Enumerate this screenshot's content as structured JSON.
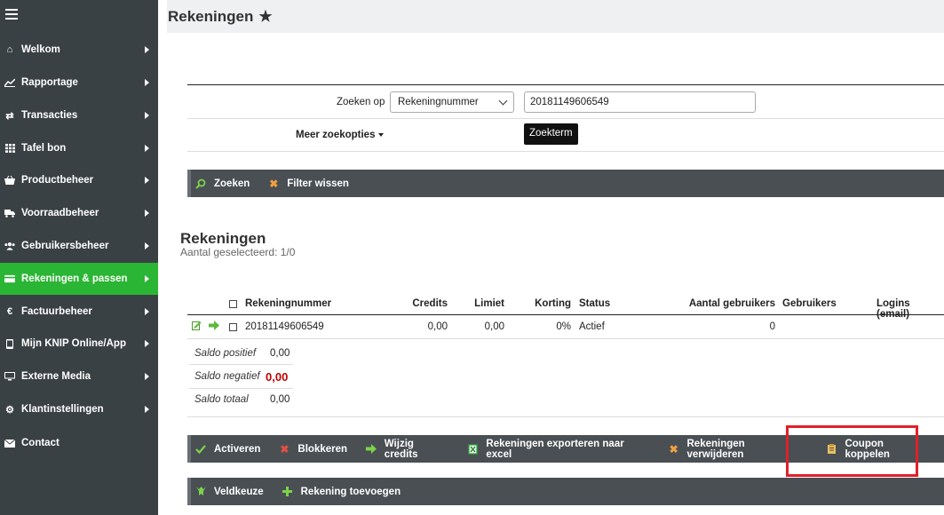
{
  "sidebar": {
    "items": [
      {
        "label": "Welkom",
        "icon": "home-icon"
      },
      {
        "label": "Rapportage",
        "icon": "chart-icon"
      },
      {
        "label": "Transacties",
        "icon": "exchange-icon"
      },
      {
        "label": "Tafel bon",
        "icon": "grid-icon"
      },
      {
        "label": "Productbeheer",
        "icon": "basket-icon"
      },
      {
        "label": "Voorraadbeheer",
        "icon": "truck-icon"
      },
      {
        "label": "Gebruikersbeheer",
        "icon": "users-icon"
      },
      {
        "label": "Rekeningen & passen",
        "icon": "credit-card-icon"
      },
      {
        "label": "Factuurbeheer",
        "icon": "euro-icon"
      },
      {
        "label": "Mijn KNIP Online/App",
        "icon": "mobile-icon"
      },
      {
        "label": "Externe Media",
        "icon": "monitor-icon"
      },
      {
        "label": "Klantinstellingen",
        "icon": "cogs-icon"
      },
      {
        "label": "Contact",
        "icon": "envelope-icon"
      }
    ],
    "active_index": 7,
    "accent": "#2bb534"
  },
  "header": {
    "title": "Rekeningen"
  },
  "search": {
    "zoeken_op_label": "Zoeken op",
    "field_selected": "Rekeningnummer",
    "term_value": "20181149606549",
    "tooltip": "Zoekterm",
    "meer_label": "Meer zoekopties"
  },
  "search_toolbar": {
    "zoeken": "Zoeken",
    "filter_wissen": "Filter wissen"
  },
  "section": {
    "title": "Rekeningen",
    "subtitle": "Aantal geselecteerd: 1/0"
  },
  "table": {
    "headers": {
      "rekeningnummer": "Rekeningnummer",
      "credits": "Credits",
      "limiet": "Limiet",
      "korting": "Korting",
      "status": "Status",
      "aantal_gebruikers": "Aantal gebruikers",
      "gebruikers": "Gebruikers",
      "logins": "Logins (email)"
    },
    "row": {
      "rekeningnummer": "20181149606549",
      "credits": "0,00",
      "limiet": "0,00",
      "korting": "0%",
      "status": "Actief",
      "aantal_gebruikers": "0"
    }
  },
  "saldo": {
    "positief_label": "Saldo positief",
    "positief_value": "0,00",
    "negatief_label": "Saldo negatief",
    "negatief_value": "0,00",
    "totaal_label": "Saldo totaal",
    "totaal_value": "0,00"
  },
  "actions_toolbar": {
    "activeren": "Activeren",
    "blokkeren": "Blokkeren",
    "wijzig_credits": "Wijzig credits",
    "exporteren": "Rekeningen exporteren naar excel",
    "verwijderen": "Rekeningen verwijderen",
    "coupon": "Coupon koppelen"
  },
  "bottom_toolbar": {
    "veldkeuze": "Veldkeuze",
    "toevoegen": "Rekening toevoegen"
  },
  "colors": {
    "sidebar_bg": "#3a4145",
    "toolbar_bg": "#4a4f54",
    "highlight": "#e0202a",
    "negative": "#c00000"
  }
}
